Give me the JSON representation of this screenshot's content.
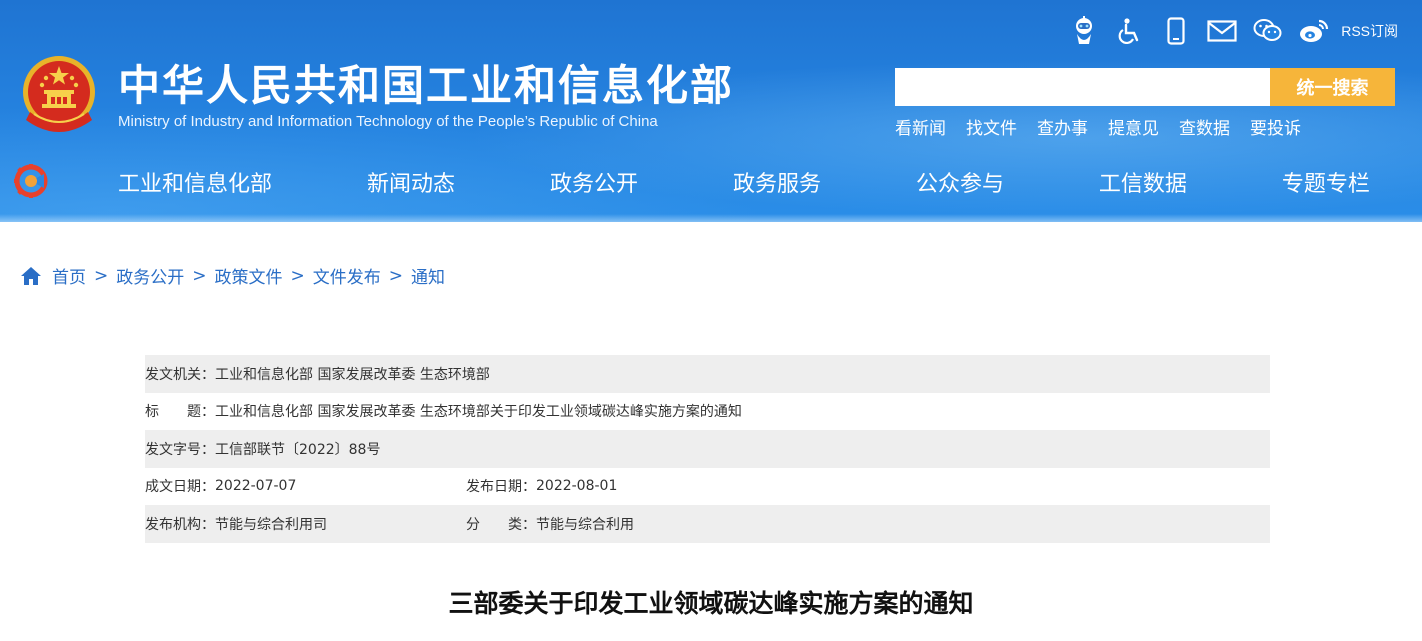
{
  "header": {
    "title_cn": "中华人民共和国工业和信息化部",
    "title_en": "Ministry of Industry and Information Technology of the People’s Republic of China",
    "utility_icons": [
      "robot-assistant-icon",
      "accessibility-icon",
      "mobile-icon",
      "mail-icon",
      "wechat-icon",
      "weibo-icon"
    ],
    "rss_label": "RSS订阅",
    "search": {
      "value": "",
      "placeholder": "",
      "button_label": "统一搜索"
    },
    "quick_links": [
      "看新闻",
      "找文件",
      "查办事",
      "提意见",
      "查数据",
      "要投诉"
    ],
    "nav": [
      "工业和信息化部",
      "新闻动态",
      "政务公开",
      "政务服务",
      "公众参与",
      "工信数据",
      "专题专栏"
    ],
    "colors": {
      "header_blue": "#2583e0",
      "search_button": "#f6b53a"
    }
  },
  "breadcrumb": [
    "首页",
    "政务公开",
    "政策文件",
    "文件发布",
    "通知"
  ],
  "breadcrumb_separator": ">",
  "meta": {
    "issuer_label": "发文机关：",
    "issuer": "工业和信息化部 国家发展改革委 生态环境部",
    "title_label": "标　　题：",
    "title": "工业和信息化部 国家发展改革委 生态环境部关于印发工业领域碳达峰实施方案的通知",
    "doc_no_label": "发文字号：",
    "doc_no": "工信部联节〔2022〕88号",
    "created_label": "成文日期：",
    "created": "2022-07-07",
    "published_label": "发布日期：",
    "published": "2022-08-01",
    "org_label": "发布机构：",
    "org": "节能与综合利用司",
    "category_label": "分　　类：",
    "category": "节能与综合利用"
  },
  "article": {
    "title": "三部委关于印发工业领域碳达峰实施方案的通知"
  }
}
